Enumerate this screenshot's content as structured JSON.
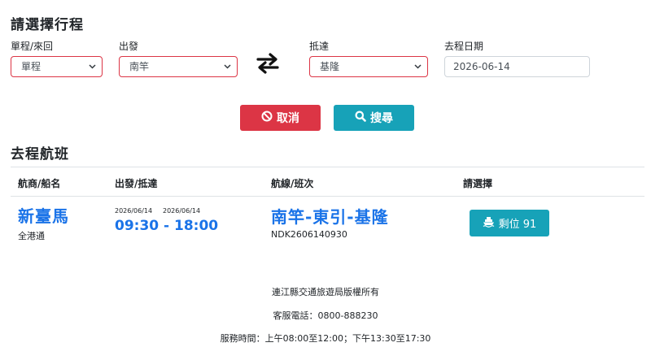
{
  "form": {
    "title": "請選擇行程",
    "trip_type": {
      "label": "單程/來回",
      "value": "單程"
    },
    "depart": {
      "label": "出發",
      "value": "南竿"
    },
    "arrive": {
      "label": "抵達",
      "value": "基隆"
    },
    "date": {
      "label": "去程日期",
      "value": "2026-06-14"
    },
    "cancel_label": "取消",
    "search_label": "搜尋"
  },
  "results": {
    "title": "去程航班",
    "headers": [
      "航商/船名",
      "出發/抵達",
      "航線/班次",
      "請選擇"
    ],
    "rows": [
      {
        "vessel": "新臺馬",
        "operator": "全港通",
        "depart_date": "2026/06/14",
        "arrive_date": "2026/06/14",
        "time_range": "09:30 - 18:00",
        "route": "南竿-東引-基隆",
        "trip_code": "NDK2606140930",
        "seat_label": "剩位 91"
      }
    ]
  },
  "footer": {
    "line1": "連江縣交通旅遊局版權所有",
    "line2": "客服電話：0800-888230",
    "line3": "服務時間：上午08:00至12:00；下午13:30至17:30"
  },
  "colors": {
    "accent_blue": "#1a73e8",
    "cancel_red": "#dc3545",
    "search_teal": "#17a2b8"
  },
  "icons": [
    "chevron-down-icon",
    "swap-icon",
    "ban-icon",
    "search-icon",
    "ship-icon"
  ]
}
